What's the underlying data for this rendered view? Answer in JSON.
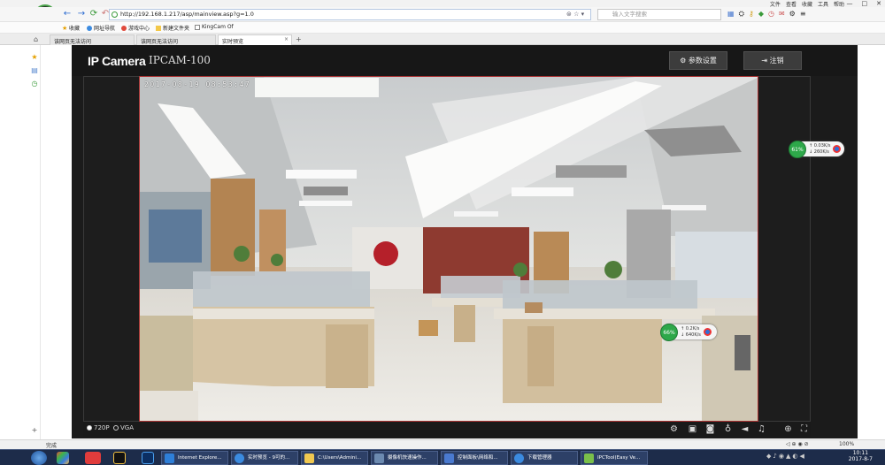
{
  "browser": {
    "top_menu": [
      "文件",
      "查看",
      "收藏",
      "工具",
      "帮助"
    ],
    "address": "http://192.168.1.217/asp/mainview.asp?g=1.0",
    "search_placeholder": "输入文字搜索",
    "favorites": [
      {
        "label": "收藏",
        "icon": "star-icon"
      },
      {
        "label": "网址导航",
        "icon": "globe-icon"
      },
      {
        "label": "游戏中心",
        "icon": "game-icon"
      },
      {
        "label": "新建文件夹",
        "icon": "folder-icon"
      },
      {
        "label": "KingCam Of",
        "icon": "page-icon"
      }
    ],
    "tabs": [
      {
        "label": "该网页无法访问",
        "active": false
      },
      {
        "label": "该网页无法访问",
        "active": false
      },
      {
        "label": "实时预览",
        "active": true
      }
    ],
    "status_left": "完成",
    "zoom": "100%"
  },
  "app": {
    "brand": "IP Camera",
    "model": "IPCAM-100",
    "settings_label": "参数设置",
    "logout_label": "注销",
    "osd_timestamp": "2017-08-19 08:53:47",
    "resolution_options": [
      {
        "label": "720P",
        "selected": true
      },
      {
        "label": "VGA",
        "selected": false
      }
    ],
    "controls": [
      "gear-icon",
      "record-icon",
      "camera-icon",
      "microphone-icon",
      "speaker-icon",
      "alarm-icon",
      "zoom-in-icon",
      "fullscreen-icon"
    ]
  },
  "network_widgets": [
    {
      "percent": "61%",
      "up": "0.03K/s",
      "down": "260K/s"
    },
    {
      "percent": "66%",
      "up": "0.2K/s",
      "down": "640K/s"
    }
  ],
  "taskbar": {
    "items": [
      "Internet Explore...",
      "实时预览 - 9可的...",
      "C:\\Users\\Admini...",
      "摄像机快速操作...",
      "控制面板\\网络和...",
      "下载管理器",
      "IPCTool(Easy Ve..."
    ],
    "time": "10:11",
    "date": "2017-8-7"
  },
  "colors": {
    "app_bg": "#1b1b1b",
    "stage_border": "#aa3333",
    "widget_green": "#2ea84a",
    "taskbar": "#1d2c4a"
  }
}
